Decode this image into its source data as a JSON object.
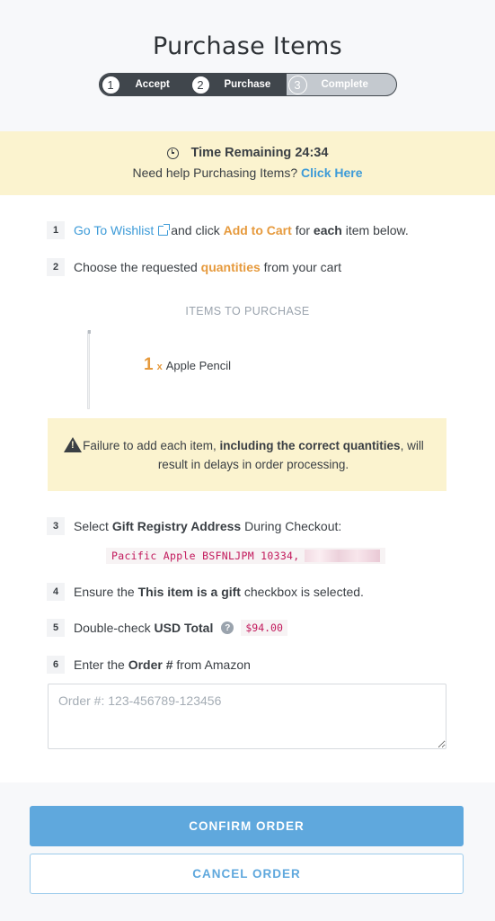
{
  "header": {
    "title": "Purchase Items",
    "steps": [
      {
        "num": "1",
        "label": "Accept"
      },
      {
        "num": "2",
        "label": "Purchase"
      },
      {
        "num": "3",
        "label": "Complete"
      }
    ]
  },
  "timer": {
    "label": "Time Remaining 24:34",
    "help_text": "Need help Purchasing Items?",
    "help_link": "Click Here"
  },
  "instructions": {
    "step1": {
      "num": "1",
      "link": "Go To Wishlist",
      "t1": "and click",
      "action": "Add to Cart",
      "t2": "for",
      "emph": "each",
      "t3": "item below."
    },
    "step2": {
      "num": "2",
      "t1": "Choose the requested",
      "emph": "quantities",
      "t2": "from your cart"
    },
    "step3": {
      "num": "3",
      "t1": "Select",
      "emph": "Gift Registry Address",
      "t2": "During Checkout:"
    },
    "step4": {
      "num": "4",
      "t1": "Ensure the",
      "emph": "This item is a gift",
      "t2": "checkbox is selected."
    },
    "step5": {
      "num": "5",
      "t1": "Double-check",
      "emph": "USD Total",
      "help": "?",
      "price": "$94.00"
    },
    "step6": {
      "num": "6",
      "t1": "Enter the",
      "emph": "Order #",
      "t2": "from Amazon"
    }
  },
  "items": {
    "title": "ITEMS TO PURCHASE",
    "list": [
      {
        "qty": "1",
        "times": "x",
        "name": "Apple Pencil"
      }
    ]
  },
  "warning": {
    "t1": "Failure to add each item,",
    "emph": "including the correct quantities",
    "t2": ", will result in delays in order processing."
  },
  "address": {
    "text": "Pacific Apple BSFNLJPM 10334,"
  },
  "order_input": {
    "placeholder": "Order #: 123-456789-123456"
  },
  "footer": {
    "confirm_label": "CONFIRM ORDER",
    "cancel_label": "CANCEL ORDER"
  }
}
